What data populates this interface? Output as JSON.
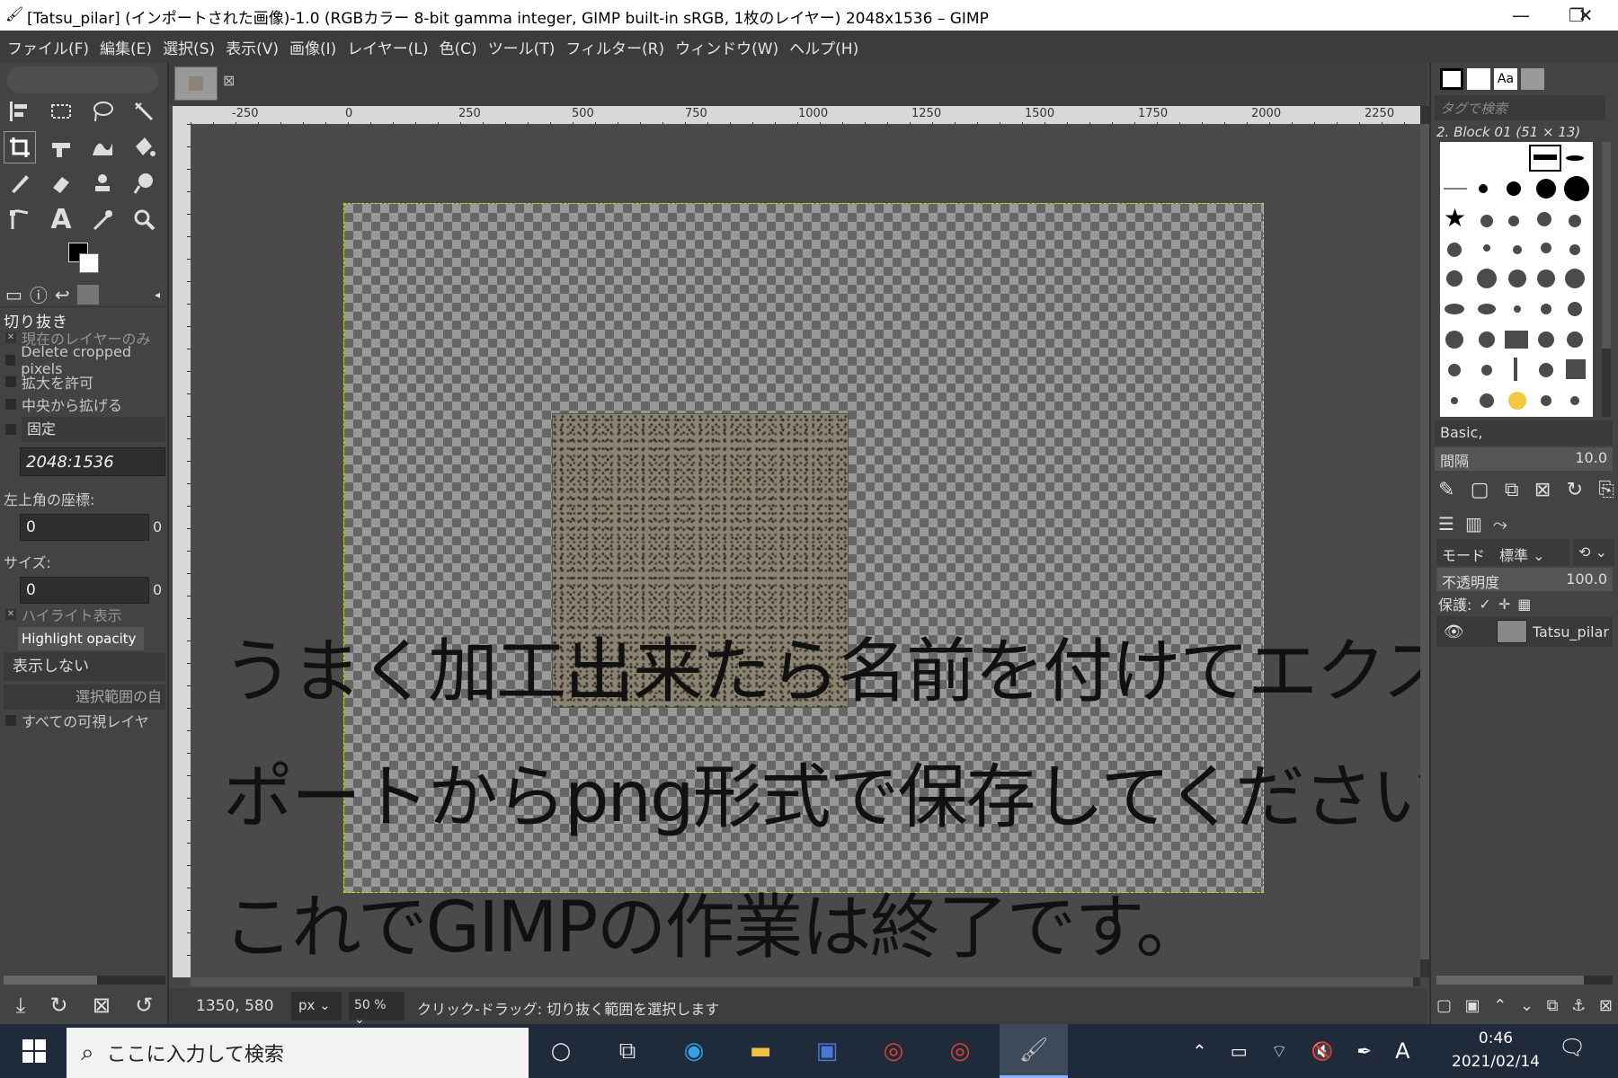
{
  "window": {
    "title": "[Tatsu_pilar] (インポートされた画像)-1.0 (RGBカラー 8-bit gamma integer, GIMP built-in sRGB, 1枚のレイヤー) 2048x1536 – GIMP",
    "minimize": "—",
    "maximize": "❐",
    "close": "✕"
  },
  "menu": [
    "ファイル(F)",
    "編集(E)",
    "選択(S)",
    "表示(V)",
    "画像(I)",
    "レイヤー(L)",
    "色(C)",
    "ツール(T)",
    "フィルター(R)",
    "ウィンドウ(W)",
    "ヘルプ(H)"
  ],
  "tool_options": {
    "title": "切り抜き",
    "current_layer_only": "現在のレイヤーのみ",
    "delete_cropped": "Delete cropped pixels",
    "allow_growing": "拡大を許可",
    "expand_center": "中央から拡げる",
    "fixed": "固定",
    "fixed_value": "2048:1536",
    "position_label": "左上角の座標:",
    "position_x": "0",
    "position_y": "0",
    "size_label": "サイズ:",
    "size_w": "0",
    "size_h": "0",
    "highlight": "ハイライト表示",
    "highlight_opacity": "Highlight opacity",
    "guides": "表示しない",
    "auto_shrink": "選択範囲の自",
    "shrink_merged": "すべての可視レイヤ"
  },
  "ruler_h": [
    "-250",
    "0",
    "250",
    "500",
    "750",
    "1000",
    "1250",
    "1500",
    "1750",
    "2000",
    "2250"
  ],
  "overlay_text": [
    "うまく加工出来たら名前を付けてエクス",
    "ポートからpng形式で保存してください。",
    "これでGIMPの作業は終了です。"
  ],
  "status": {
    "coords": "1350, 580",
    "unit": "px",
    "zoom": "50 %",
    "message": "クリック-ドラッグ: 切り抜く範囲を選択します"
  },
  "brushes": {
    "tag_search_placeholder": "タグで検索",
    "current": "2. Block 01 (51 × 13)",
    "preset": "Basic,",
    "spacing_label": "間隔",
    "spacing_value": "10.0"
  },
  "layers": {
    "mode_label": "モード",
    "mode_value": "標準",
    "opacity_label": "不透明度",
    "opacity_value": "100.0",
    "lock_label": "保護:",
    "layer_name": "Tatsu_pilar"
  },
  "taskbar": {
    "search_placeholder": "ここに入力して検索",
    "time": "0:46",
    "date": "2021/02/14",
    "ime": "A"
  }
}
